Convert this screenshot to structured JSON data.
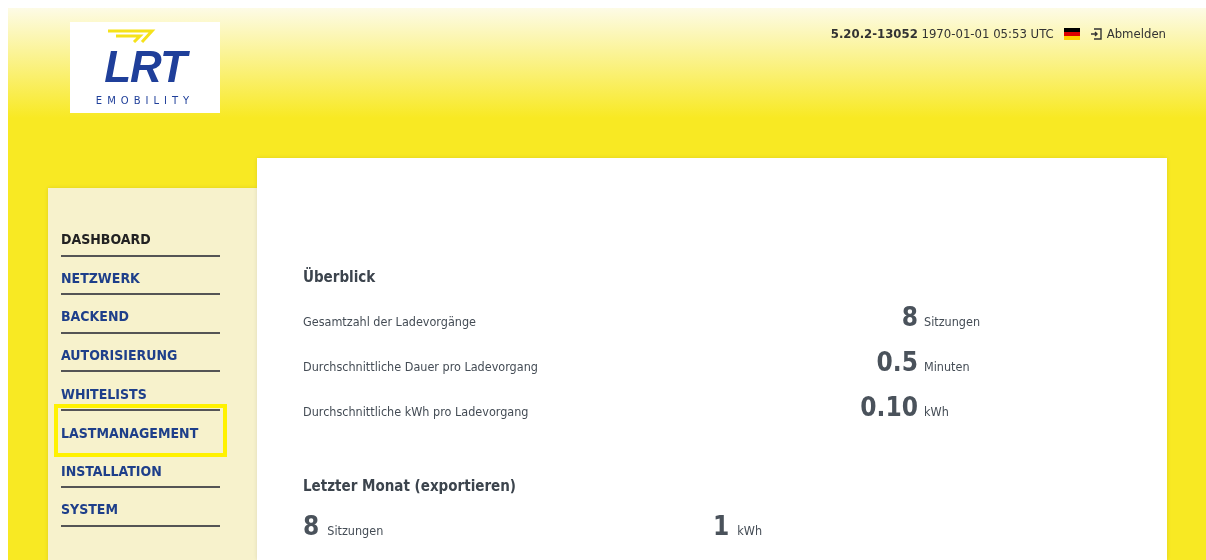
{
  "logo": {
    "mark": "LRT",
    "tagline": "EMOBILITY"
  },
  "header": {
    "version": "5.20.2-13052",
    "datetime": "1970-01-01 05:53 UTC",
    "logout": "Abmelden"
  },
  "sidebar": {
    "items": [
      {
        "label": "DASHBOARD",
        "selected": true,
        "highlighted": false
      },
      {
        "label": "NETZWERK",
        "selected": false,
        "highlighted": false
      },
      {
        "label": "BACKEND",
        "selected": false,
        "highlighted": false
      },
      {
        "label": "AUTORISIERUNG",
        "selected": false,
        "highlighted": false
      },
      {
        "label": "WHITELISTS",
        "selected": false,
        "highlighted": false
      },
      {
        "label": "LASTMANAGEMENT",
        "selected": false,
        "highlighted": true
      },
      {
        "label": "INSTALLATION",
        "selected": false,
        "highlighted": false
      },
      {
        "label": "SYSTEM",
        "selected": false,
        "highlighted": false
      }
    ]
  },
  "overview": {
    "title": "Überblick",
    "rows": [
      {
        "label": "Gesamtzahl der Ladevorgänge",
        "value": "8",
        "unit": "Sitzungen"
      },
      {
        "label": "Durchschnittliche Dauer pro Ladevorgang",
        "value": "0.5",
        "unit": "Minuten"
      },
      {
        "label": "Durchschnittliche kWh pro Ladevorgang",
        "value": "0.10",
        "unit": "kWh"
      }
    ]
  },
  "last_month": {
    "title": "Letzter Monat (exportieren)",
    "stats": [
      {
        "value": "8",
        "unit": "Sitzungen"
      },
      {
        "value": "1",
        "unit": "kWh"
      }
    ]
  }
}
